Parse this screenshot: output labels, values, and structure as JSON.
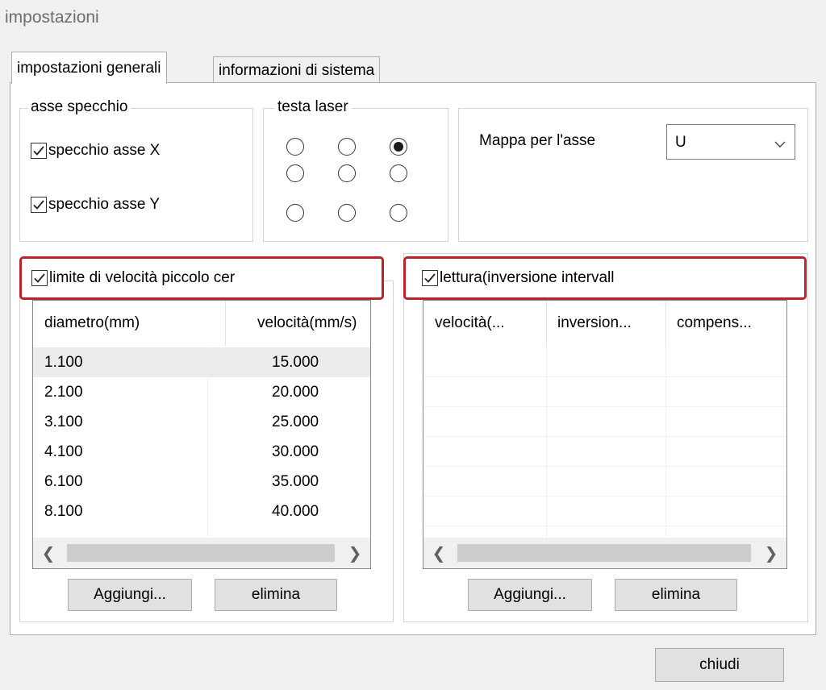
{
  "window": {
    "title": "impostazioni"
  },
  "tabs": [
    {
      "label": "impostazioni generali",
      "active": true
    },
    {
      "label": "informazioni di sistema",
      "active": false
    }
  ],
  "mirror_axis": {
    "legend": "asse specchio",
    "x_label": "specchio asse X",
    "x_checked": true,
    "y_label": "specchio asse Y",
    "y_checked": true
  },
  "laser_head": {
    "legend": "testa laser",
    "selected_index": 2,
    "count": 9
  },
  "axis_map": {
    "label": "Mappa per l'asse",
    "value": "U"
  },
  "small_circle_speed": {
    "checkbox_label": "limite di velocità piccolo cer",
    "checked": true,
    "columns": [
      "diametro(mm)",
      "velocità(mm/s)"
    ],
    "rows": [
      [
        "1.100",
        "15.000"
      ],
      [
        "2.100",
        "20.000"
      ],
      [
        "3.100",
        "25.000"
      ],
      [
        "4.100",
        "30.000"
      ],
      [
        "6.100",
        "35.000"
      ],
      [
        "8.100",
        "40.000"
      ]
    ],
    "selected_row": 0,
    "add_label": "Aggiungi...",
    "delete_label": "elimina"
  },
  "backlash": {
    "checkbox_label": "lettura(inversione intervall",
    "checked": true,
    "columns": [
      "velocità(...",
      "inversion...",
      "compens..."
    ],
    "rows": [],
    "add_label": "Aggiungi...",
    "delete_label": "elimina"
  },
  "footer": {
    "close_label": "chiudi"
  },
  "colors": {
    "highlight": "#c0202a",
    "selected_row": "#ececec"
  }
}
